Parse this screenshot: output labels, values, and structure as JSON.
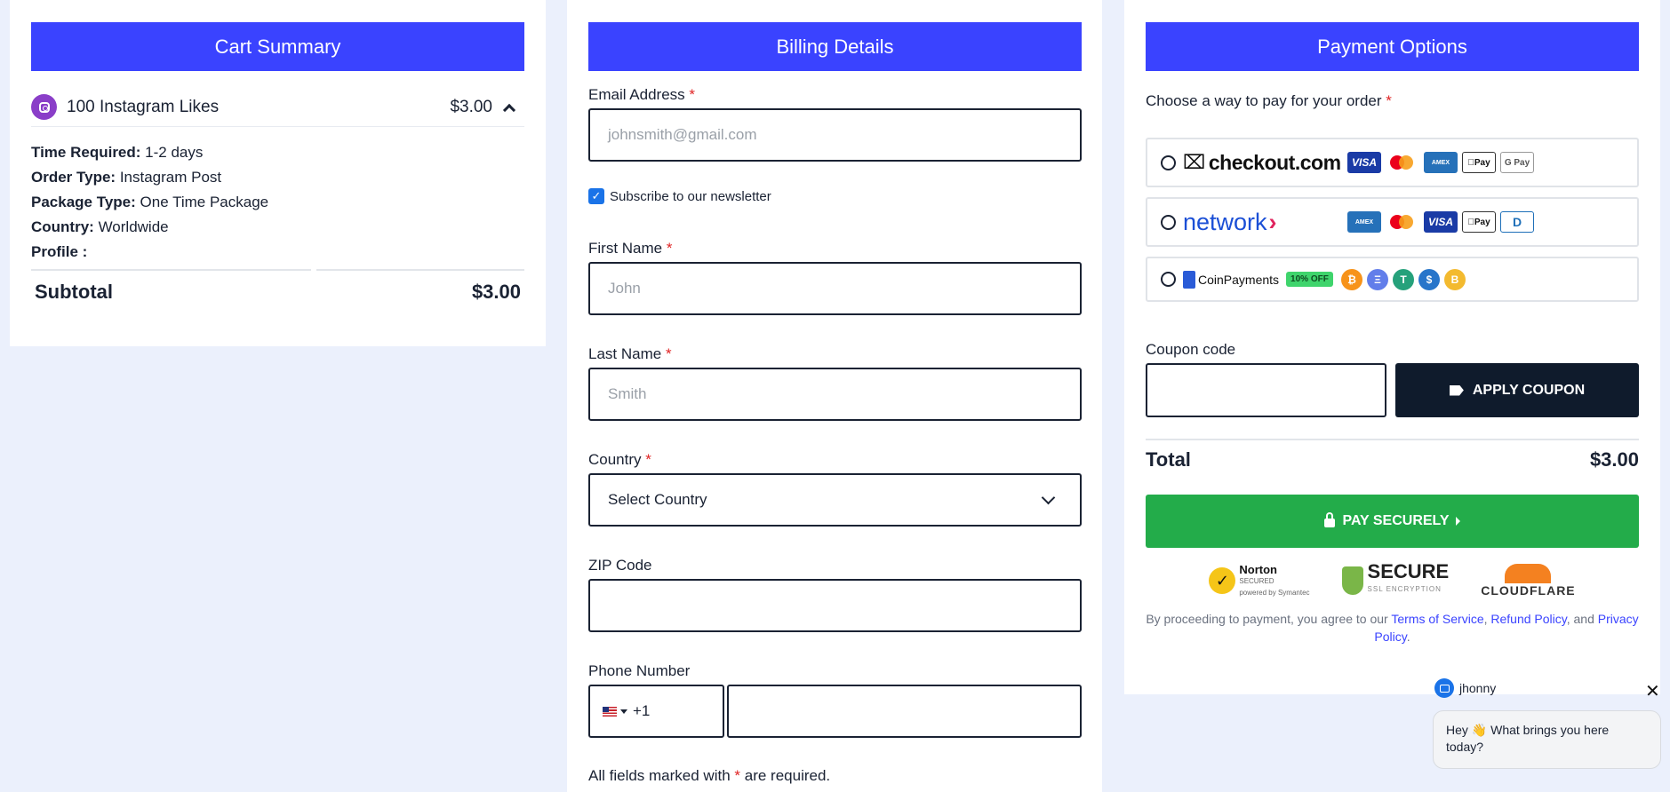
{
  "cart": {
    "title": "Cart Summary",
    "item": {
      "name": "100 Instagram Likes",
      "price": "$3.00"
    },
    "details": [
      {
        "label": "Time Required:",
        "value": "1-2 days"
      },
      {
        "label": "Order Type:",
        "value": "Instagram Post"
      },
      {
        "label": "Package Type:",
        "value": "One Time Package"
      },
      {
        "label": "Country:",
        "value": "Worldwide"
      },
      {
        "label": "Profile :",
        "value": ""
      }
    ],
    "subtotal_label": "Subtotal",
    "subtotal_value": "$3.00"
  },
  "billing": {
    "title": "Billing Details",
    "email_label": "Email Address",
    "email_placeholder": "johnsmith@gmail.com",
    "newsletter_label": "Subscribe to our newsletter",
    "first_name_label": "First Name",
    "first_name_placeholder": "John",
    "last_name_label": "Last Name",
    "last_name_placeholder": "Smith",
    "country_label": "Country",
    "country_value": "Select Country",
    "zip_label": "ZIP Code",
    "phone_label": "Phone Number",
    "phone_code": "+1",
    "required_star": "*",
    "required_note_pre": "All fields marked with",
    "required_note_post": "are required."
  },
  "payment": {
    "title": "Payment Options",
    "lead": "Choose a way to pay for your order",
    "options": [
      {
        "brand": "checkout.com",
        "cards": [
          "VISA",
          "MC",
          "AMEX",
          "Pay",
          "G Pay"
        ]
      },
      {
        "brand": "network",
        "cards": [
          "AMEX",
          "MC",
          "VISA",
          "Pay",
          "D"
        ]
      },
      {
        "brand": "CoinPayments",
        "badge": "10% OFF",
        "coins": [
          "₿",
          "Ξ",
          "T",
          "$",
          "B"
        ]
      }
    ],
    "coupon_label": "Coupon code",
    "coupon_button": "APPLY COUPON",
    "total_label": "Total",
    "total_value": "$3.00",
    "pay_button": "PAY SECURELY",
    "badges": {
      "norton": "Norton",
      "norton_sub": "SECURED",
      "norton_sub2": "powered by Symantec",
      "secure": "SECURE",
      "secure_sub": "SSL ENCRYPTION",
      "cloudflare": "CLOUDFLARE"
    },
    "legal_pre": "By proceeding to payment, you agree to our",
    "terms": "Terms of Service",
    "refund": "Refund Policy",
    "legal_and": ", and",
    "privacy": "Privacy Policy"
  },
  "chat": {
    "agent": "jhonny",
    "message": "Hey 👋 What brings you here today?",
    "close": "✕"
  },
  "colors": {
    "header": "#3a43ff",
    "pay": "#23ac4a",
    "coupon_button": "#0f1b2c",
    "page_bg": "#ebf0fc"
  }
}
